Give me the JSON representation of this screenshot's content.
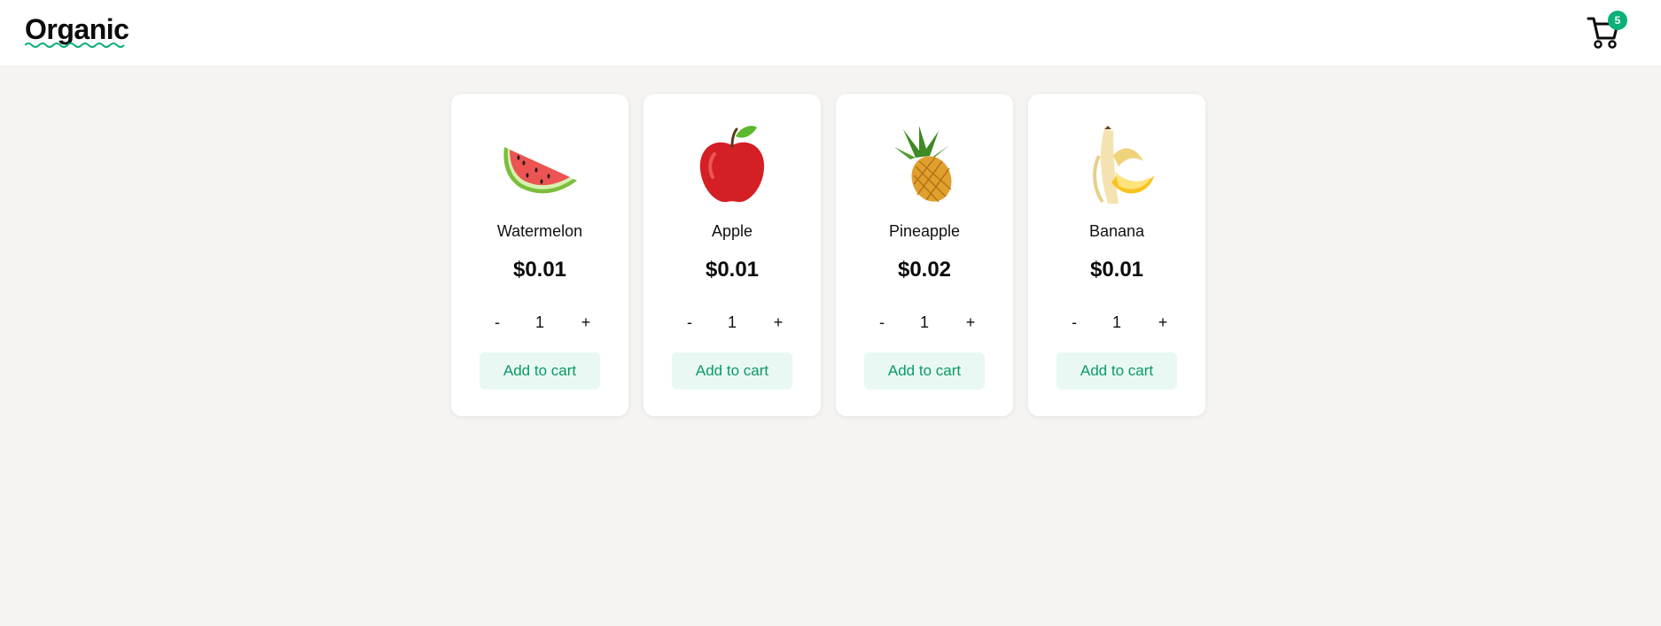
{
  "header": {
    "logo": "Organic",
    "cart_count": "5",
    "colors": {
      "accent": "#0bb07a",
      "logo_underline": "#0bb07a"
    },
    "icons": {
      "cart": "shopping-cart-icon"
    }
  },
  "products": [
    {
      "name": "Watermelon",
      "price": "$0.01",
      "quantity": "1",
      "minus_label": "-",
      "plus_label": "+",
      "add_label": "Add to cart",
      "image": "watermelon-icon"
    },
    {
      "name": "Apple",
      "price": "$0.01",
      "quantity": "1",
      "minus_label": "-",
      "plus_label": "+",
      "add_label": "Add to cart",
      "image": "apple-icon"
    },
    {
      "name": "Pineapple",
      "price": "$0.02",
      "quantity": "1",
      "minus_label": "-",
      "plus_label": "+",
      "add_label": "Add to cart",
      "image": "pineapple-icon"
    },
    {
      "name": "Banana",
      "price": "$0.01",
      "quantity": "1",
      "minus_label": "-",
      "plus_label": "+",
      "add_label": "Add to cart",
      "image": "banana-icon"
    }
  ]
}
